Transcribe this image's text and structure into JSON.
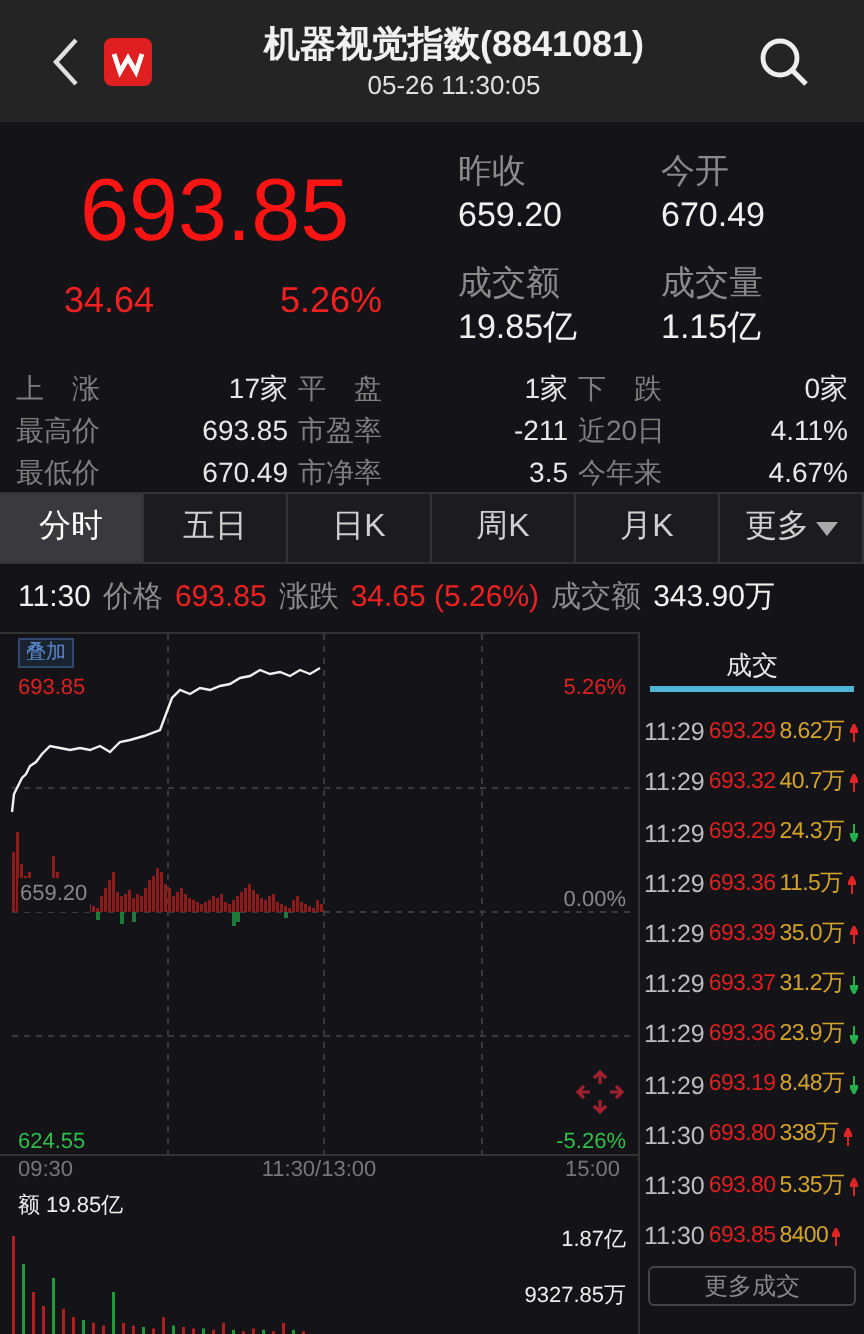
{
  "header": {
    "title": "机器视觉指数(8841081)",
    "datetime": "05-26 11:30:05"
  },
  "quote": {
    "price": "693.85",
    "change": "34.64",
    "change_pct": "5.26%",
    "fields": [
      {
        "label": "昨收",
        "value": "659.20"
      },
      {
        "label": "今开",
        "value": "670.49"
      },
      {
        "label": "成交额",
        "value": "19.85亿"
      },
      {
        "label": "成交量",
        "value": "1.15亿"
      }
    ]
  },
  "stats": [
    [
      {
        "label": "上　涨",
        "value": "17家"
      },
      {
        "label": "平　盘",
        "value": "1家"
      },
      {
        "label": "下　跌",
        "value": "0家"
      }
    ],
    [
      {
        "label": "最高价",
        "value": "693.85"
      },
      {
        "label": "市盈率",
        "value": "-211"
      },
      {
        "label": "近20日",
        "value": "4.11%"
      }
    ],
    [
      {
        "label": "最低价",
        "value": "670.49"
      },
      {
        "label": "市净率",
        "value": "3.5"
      },
      {
        "label": "今年来",
        "value": "4.67%"
      }
    ]
  ],
  "tabs": [
    {
      "label": "分时",
      "selected": true,
      "has_menu": false
    },
    {
      "label": "五日",
      "selected": false,
      "has_menu": false
    },
    {
      "label": "日K",
      "selected": false,
      "has_menu": false
    },
    {
      "label": "周K",
      "selected": false,
      "has_menu": false
    },
    {
      "label": "月K",
      "selected": false,
      "has_menu": false
    },
    {
      "label": "更多",
      "selected": false,
      "has_menu": true
    }
  ],
  "info_line": {
    "time": "11:30",
    "price_label": "价格",
    "price": "693.85",
    "change_label": "涨跌",
    "change": "34.65 (5.26%)",
    "amount_label": "成交额",
    "amount": "343.90万"
  },
  "chart": {
    "overlay_button": "叠加",
    "high": "693.85",
    "high_pct": "5.26%",
    "base": "659.20",
    "base_pct": "0.00%",
    "low": "624.55",
    "low_pct": "-5.26%",
    "time_start": "09:30",
    "time_mid": "11:30/13:00",
    "time_end": "15:00",
    "volume_total": "额 19.85亿",
    "volume_max": "1.87亿",
    "volume_mid": "9327.85万"
  },
  "trades_tab": "成交",
  "trades": [
    {
      "time": "11:29",
      "price": "693.29",
      "volume": "8.62万",
      "up": true
    },
    {
      "time": "11:29",
      "price": "693.32",
      "volume": "40.7万",
      "up": true
    },
    {
      "time": "11:29",
      "price": "693.29",
      "volume": "24.3万",
      "up": false
    },
    {
      "time": "11:29",
      "price": "693.36",
      "volume": "11.5万",
      "up": true
    },
    {
      "time": "11:29",
      "price": "693.39",
      "volume": "35.0万",
      "up": true
    },
    {
      "time": "11:29",
      "price": "693.37",
      "volume": "31.2万",
      "up": false
    },
    {
      "time": "11:29",
      "price": "693.36",
      "volume": "23.9万",
      "up": false
    },
    {
      "time": "11:29",
      "price": "693.19",
      "volume": "8.48万",
      "up": false
    },
    {
      "time": "11:30",
      "price": "693.80",
      "volume": "338万",
      "up": true
    },
    {
      "time": "11:30",
      "price": "693.80",
      "volume": "5.35万",
      "up": true
    },
    {
      "time": "11:30",
      "price": "693.85",
      "volume": "8400",
      "up": true
    }
  ],
  "more_trades_button": "更多成交"
}
